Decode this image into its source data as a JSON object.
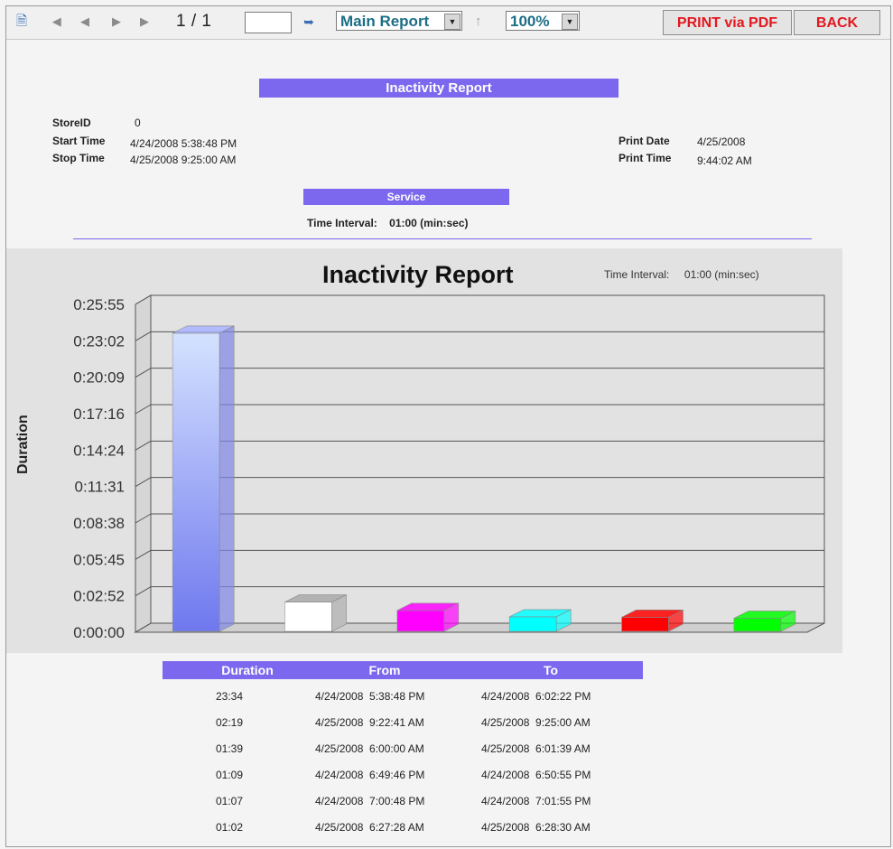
{
  "toolbar": {
    "export_icon": "export-icon",
    "page_indicator": "1 / 1",
    "page_input_value": "",
    "report_select": "Main Report",
    "zoom_select": "100%",
    "print_button": "PRINT via PDF",
    "back_button": "BACK"
  },
  "header": {
    "title": "Inactivity  Report",
    "store_id_label": "StoreID",
    "store_id_value": "0",
    "start_time_label": "Start Time",
    "start_time_value": "4/24/2008  5:38:48 PM",
    "stop_time_label": "Stop Time",
    "stop_time_value": "4/25/2008  9:25:00 AM",
    "print_date_label": "Print Date",
    "print_date_value": "4/25/2008",
    "print_time_label": "Print Time",
    "print_time_value": "9:44:02 AM",
    "service_label": "Service",
    "time_interval_label": "Time Interval:",
    "time_interval_value": "01:00 (min:sec)"
  },
  "chart_data": {
    "type": "bar",
    "title": "Inactivity Report",
    "subtitle_label": "Time Interval:",
    "subtitle_value": "01:00 (min:sec)",
    "ylabel": "Duration",
    "xlabel": "",
    "yticks": [
      "0:00:00",
      "0:02:52",
      "0:05:45",
      "0:08:38",
      "0:11:31",
      "0:14:24",
      "0:17:16",
      "0:20:09",
      "0:23:02",
      "0:25:55"
    ],
    "ylim_seconds": [
      0,
      1555
    ],
    "values_seconds": [
      1414,
      139,
      99,
      69,
      67,
      62
    ],
    "colors": [
      "#7e86f2",
      "#ffffff",
      "#ff00ff",
      "#00ffff",
      "#ff0000",
      "#00ff00"
    ],
    "grid": true,
    "legend": "none"
  },
  "table": {
    "headers": [
      "Duration",
      "From",
      "To"
    ],
    "rows": [
      [
        "23:34",
        "4/24/2008  5:38:48 PM",
        "4/24/2008  6:02:22 PM"
      ],
      [
        "02:19",
        "4/25/2008  9:22:41 AM",
        "4/25/2008  9:25:00 AM"
      ],
      [
        "01:39",
        "4/25/2008  6:00:00 AM",
        "4/25/2008  6:01:39 AM"
      ],
      [
        "01:09",
        "4/24/2008  6:49:46 PM",
        "4/24/2008  6:50:55 PM"
      ],
      [
        "01:07",
        "4/24/2008  7:00:48 PM",
        "4/24/2008  7:01:55 PM"
      ],
      [
        "01:02",
        "4/25/2008  6:27:28 AM",
        "4/25/2008  6:28:30 AM"
      ]
    ]
  }
}
